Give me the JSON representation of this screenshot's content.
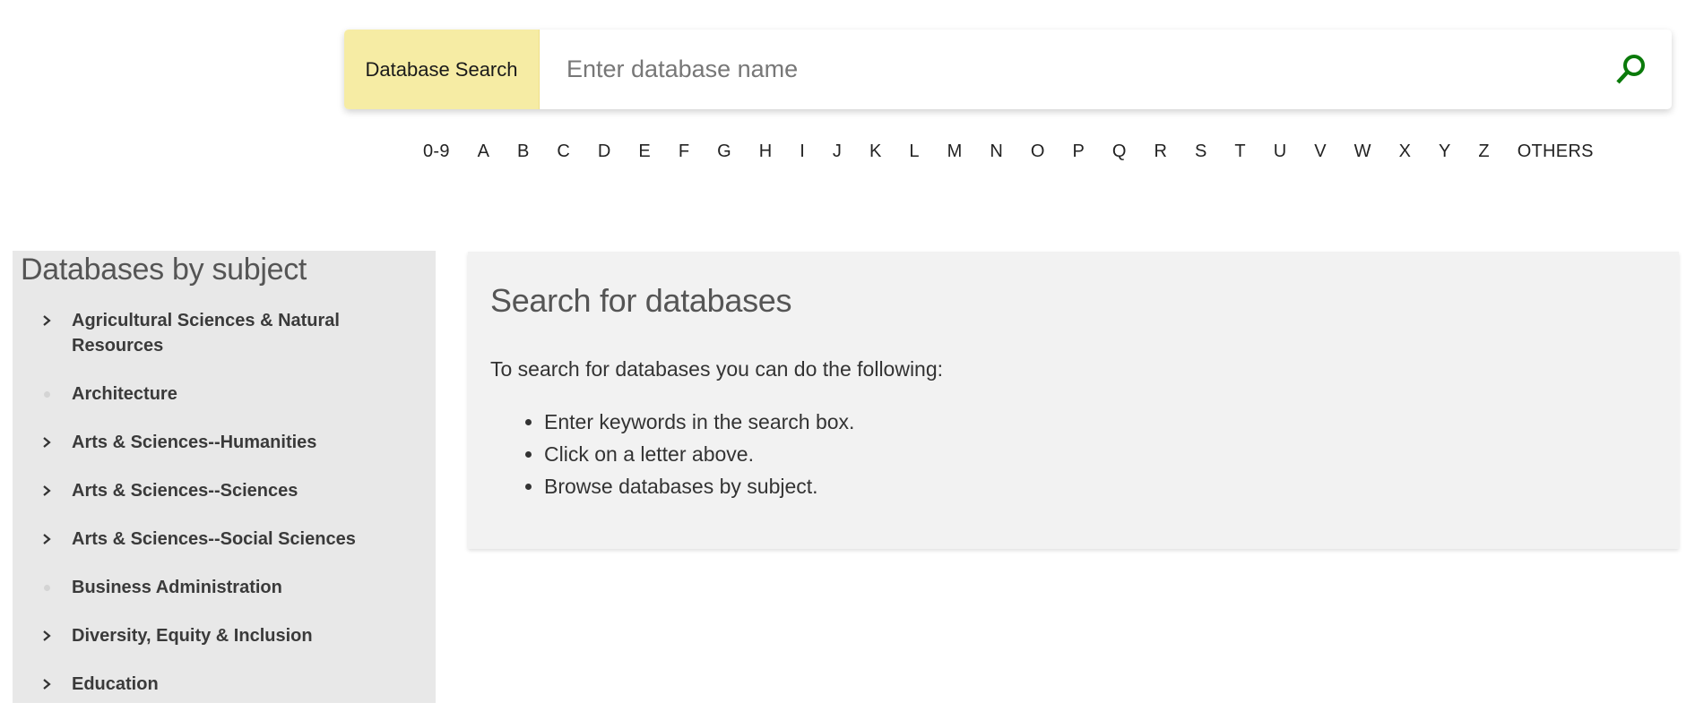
{
  "search": {
    "label": "Database Search",
    "placeholder": "Enter database name",
    "value": "",
    "button_icon": "search-icon",
    "accent_color": "#0a7a0a",
    "label_bg": "#f6eca4"
  },
  "letters": [
    "0-9",
    "A",
    "B",
    "C",
    "D",
    "E",
    "F",
    "G",
    "H",
    "I",
    "J",
    "K",
    "L",
    "M",
    "N",
    "O",
    "P",
    "Q",
    "R",
    "S",
    "T",
    "U",
    "V",
    "W",
    "X",
    "Y",
    "Z",
    "OTHERS"
  ],
  "sidebar": {
    "title": "Databases by subject",
    "items": [
      {
        "label": "Agricultural Sciences & Natural Resources",
        "marker": "chevron-right-icon",
        "expandable": true
      },
      {
        "label": "Architecture",
        "marker": "bullet-dot-icon",
        "expandable": false
      },
      {
        "label": "Arts & Sciences--Humanities",
        "marker": "chevron-right-icon",
        "expandable": true
      },
      {
        "label": "Arts & Sciences--Sciences",
        "marker": "chevron-right-icon",
        "expandable": true
      },
      {
        "label": "Arts & Sciences--Social Sciences",
        "marker": "chevron-right-icon",
        "expandable": true
      },
      {
        "label": "Business Administration",
        "marker": "bullet-dot-icon",
        "expandable": false
      },
      {
        "label": "Diversity, Equity & Inclusion",
        "marker": "chevron-right-icon",
        "expandable": true
      },
      {
        "label": "Education",
        "marker": "chevron-right-icon",
        "expandable": true
      }
    ]
  },
  "main": {
    "title": "Search for databases",
    "intro": "To search for databases you can do the following:",
    "steps": [
      "Enter keywords in the search box.",
      "Click on a letter above.",
      "Browse databases by subject."
    ]
  }
}
